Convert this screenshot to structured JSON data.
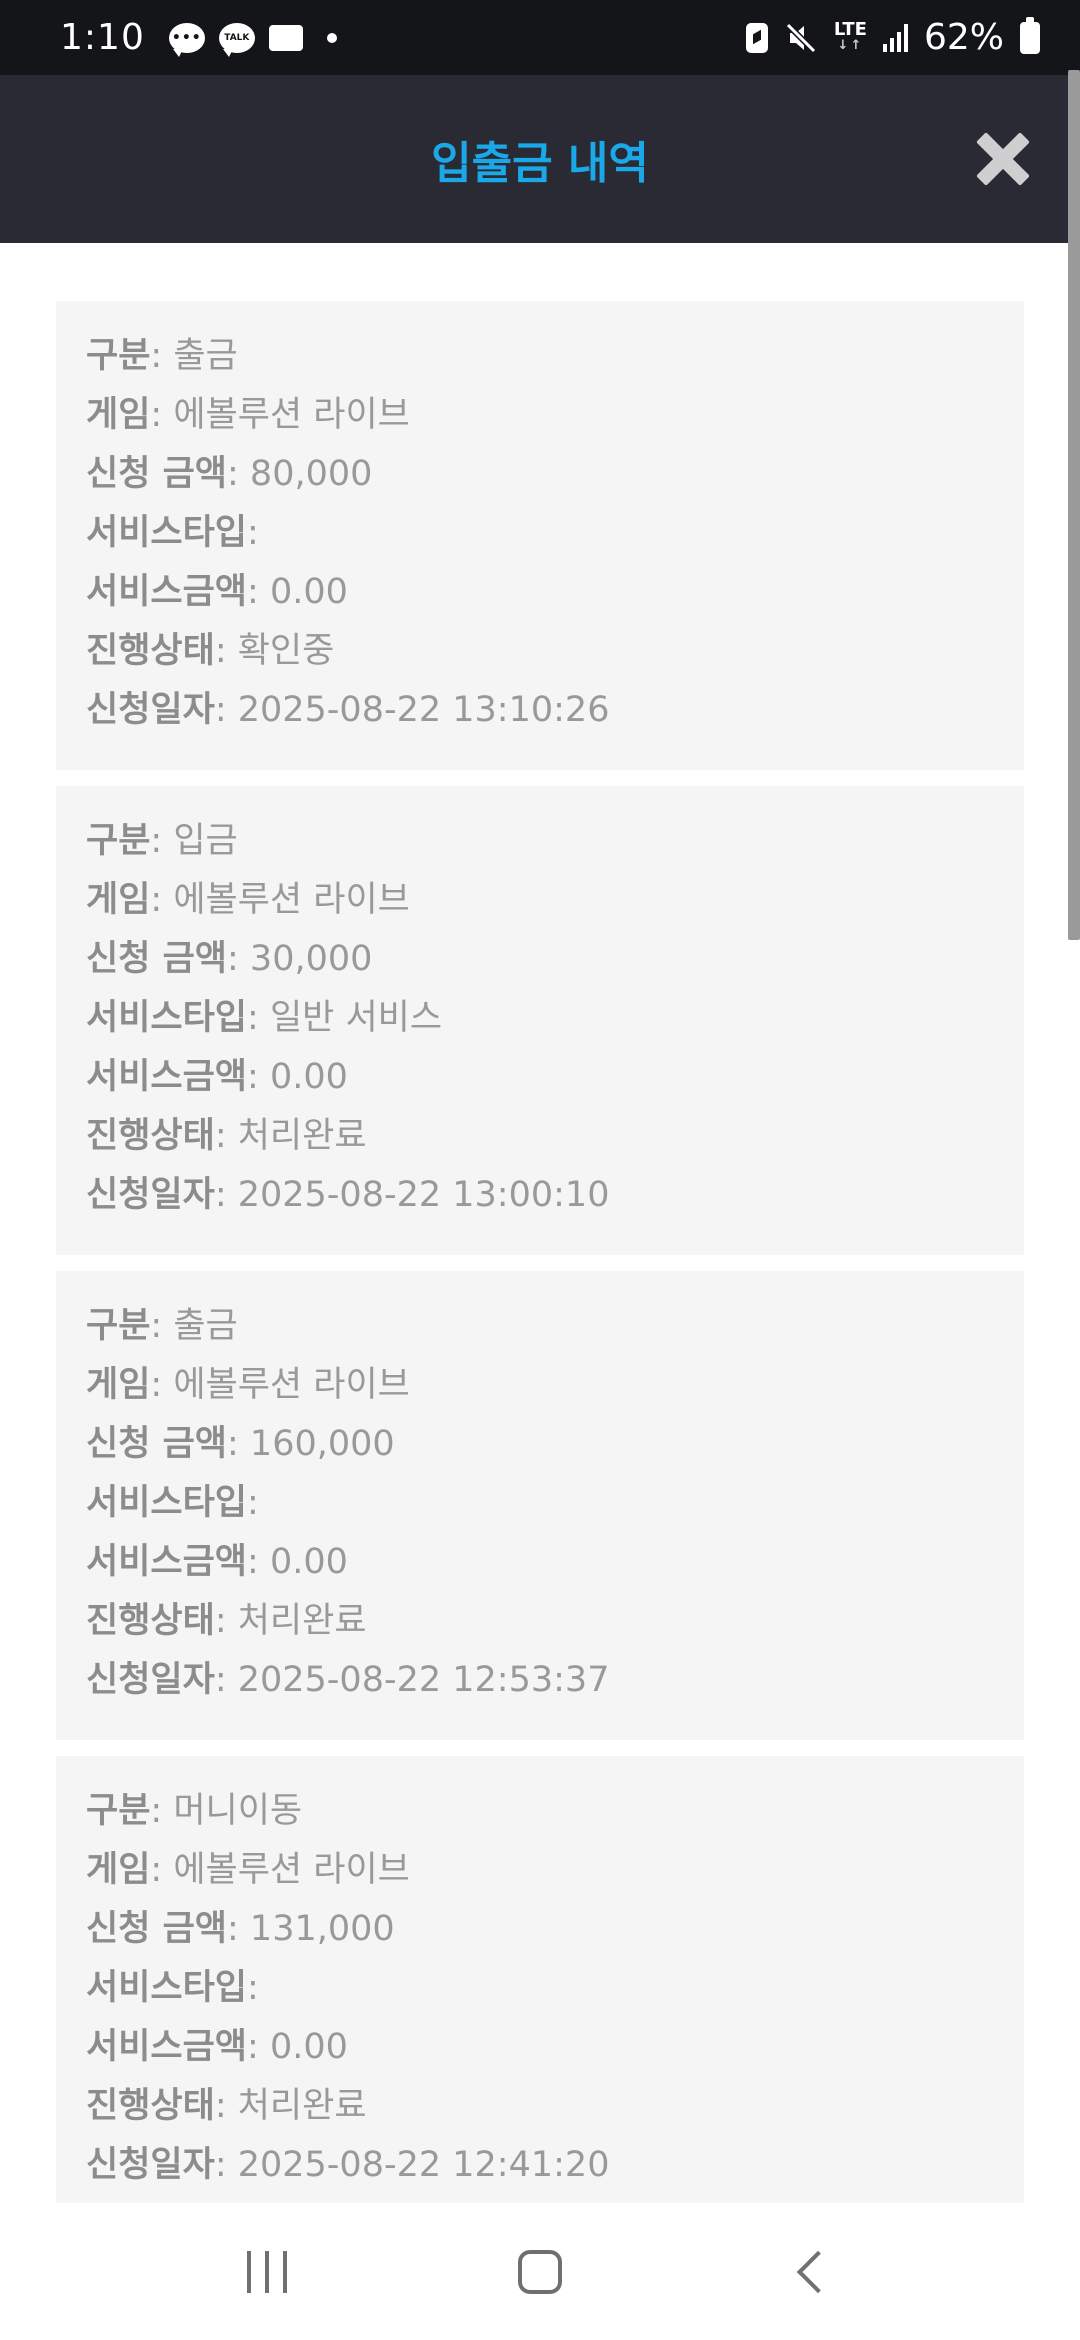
{
  "status_bar": {
    "time": "1:10",
    "talk_label": "TALK",
    "network": "LTE",
    "battery_percent": "62%"
  },
  "header": {
    "title": "입출금 내역"
  },
  "labels": {
    "type": "구분",
    "game": "게임",
    "amount": "신청 금액",
    "service_type": "서비스타입",
    "service_amount": "서비스금액",
    "status": "진행상태",
    "date": "신청일자"
  },
  "records": [
    {
      "type": "출금",
      "game": "에볼루션 라이브",
      "amount": "80,000",
      "service_type": "",
      "service_amount": "0.00",
      "status": "확인중",
      "date": "2025-08-22 13:10:26"
    },
    {
      "type": "입금",
      "game": "에볼루션 라이브",
      "amount": "30,000",
      "service_type": "일반 서비스",
      "service_amount": "0.00",
      "status": "처리완료",
      "date": "2025-08-22 13:00:10"
    },
    {
      "type": "출금",
      "game": "에볼루션 라이브",
      "amount": "160,000",
      "service_type": "",
      "service_amount": "0.00",
      "status": "처리완료",
      "date": "2025-08-22 12:53:37"
    },
    {
      "type": "머니이동",
      "game": "에볼루션 라이브",
      "amount": "131,000",
      "service_type": "",
      "service_amount": "0.00",
      "status": "처리완료",
      "date": "2025-08-22 12:41:20"
    }
  ],
  "colors": {
    "accent": "#1aa8e8",
    "header_bg": "#292a33",
    "status_bar_bg": "#141519",
    "card_bg": "#f5f5f5"
  }
}
